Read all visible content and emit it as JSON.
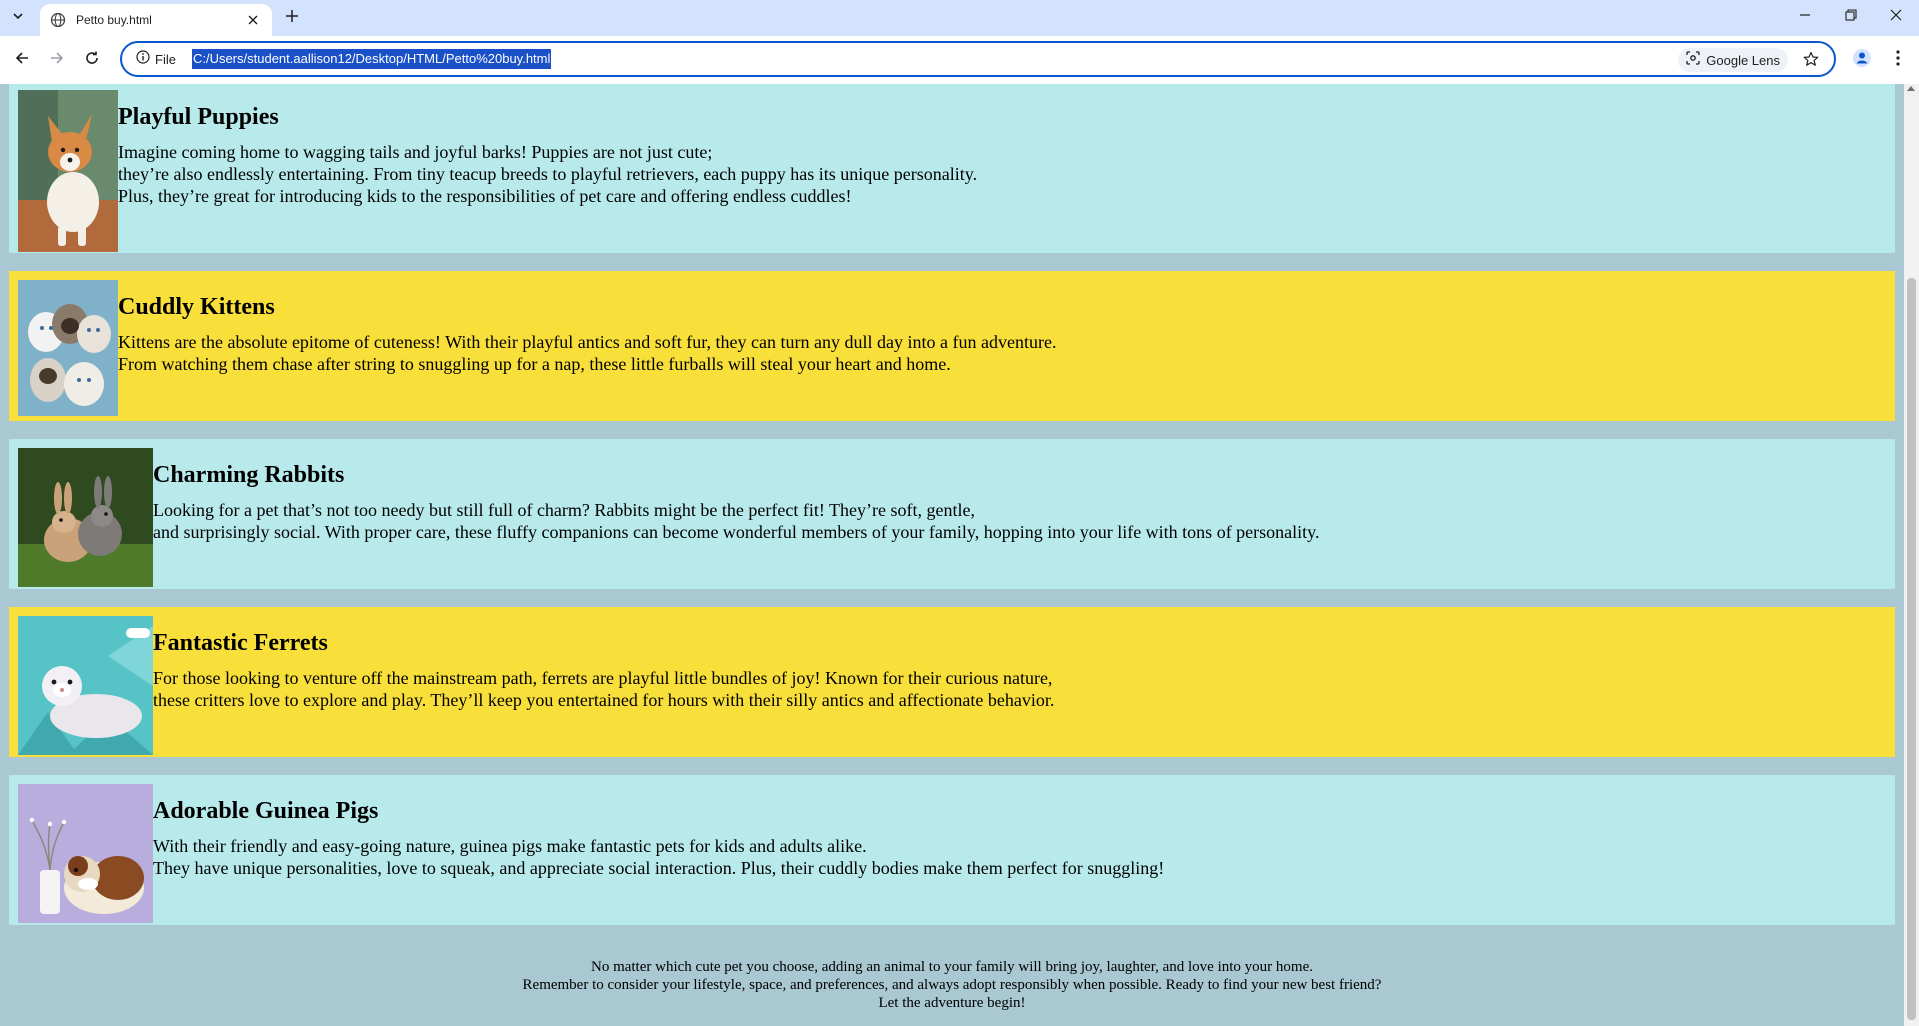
{
  "browser": {
    "tab_title": "Petto buy.html",
    "site_info_label": "File",
    "url": "C:/Users/student.aallison12/Desktop/HTML/Petto%20buy.html",
    "lens_label": "Google Lens"
  },
  "pets": [
    {
      "title": "Playful Puppies",
      "lines": [
        "Imagine coming home to wagging tails and joyful barks! Puppies are not just cute;",
        "they’re also endlessly entertaining. From tiny teacup breeds to playful retrievers, each puppy has its unique personality.",
        "Plus, they’re great for introducing kids to the responsibilities of pet care and offering endless cuddles!"
      ]
    },
    {
      "title": "Cuddly Kittens",
      "lines": [
        "Kittens are the absolute epitome of cuteness! With their playful antics and soft fur, they can turn any dull day into a fun adventure.",
        "From watching them chase after string to snuggling up for a nap, these little furballs will steal your heart and home."
      ]
    },
    {
      "title": "Charming Rabbits",
      "lines": [
        "Looking for a pet that’s not too needy but still full of charm? Rabbits might be the perfect fit! They’re soft, gentle,",
        "and surprisingly social. With proper care, these fluffy companions can become wonderful members of your family, hopping into your life with tons of personality."
      ]
    },
    {
      "title": "Fantastic Ferrets",
      "lines": [
        "For those looking to venture off the mainstream path, ferrets are playful little bundles of joy! Known for their curious nature,",
        "these critters love to explore and play. They’ll keep you entertained for hours with their silly antics and affectionate behavior."
      ]
    },
    {
      "title": "Adorable Guinea Pigs",
      "lines": [
        "With their friendly and easy-going nature, guinea pigs make fantastic pets for kids and adults alike.",
        "They have unique personalities, love to squeak, and appreciate social interaction. Plus, their cuddly bodies make them perfect for snuggling!"
      ]
    }
  ],
  "footer": {
    "lines": [
      "No matter which cute pet you choose, adding an animal to your family will bring joy, laughter, and love into your home.",
      "Remember to consider your lifestyle, space, and preferences, and always adopt responsibly when possible. Ready to find your new best friend?",
      "Let the adventure begin!"
    ]
  }
}
